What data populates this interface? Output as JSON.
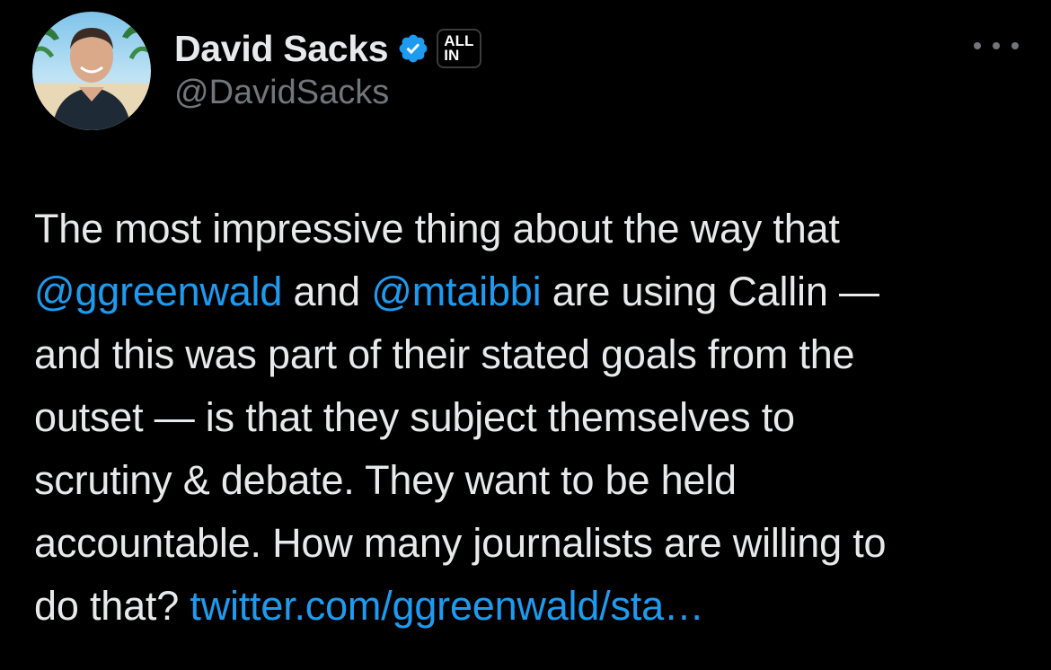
{
  "user": {
    "display_name": "David Sacks",
    "handle": "@DavidSacks",
    "verified_icon": "verified-badge-icon",
    "affiliate_badge_line1": "ALL",
    "affiliate_badge_line2": "IN"
  },
  "more_icon": "more-options-icon",
  "tweet": {
    "lines": [
      [
        {
          "text": "The most impressive thing about the way that",
          "kind": "text"
        }
      ],
      [
        {
          "text": "@ggreenwald",
          "kind": "mention"
        },
        {
          "text": " and ",
          "kind": "text"
        },
        {
          "text": "@mtaibbi",
          "kind": "mention"
        },
        {
          "text": " are using Callin —",
          "kind": "text"
        }
      ],
      [
        {
          "text": "and this was part of their stated goals from the",
          "kind": "text"
        }
      ],
      [
        {
          "text": "outset — is that they subject themselves to",
          "kind": "text"
        }
      ],
      [
        {
          "text": "scrutiny & debate. They want to be held",
          "kind": "text"
        }
      ],
      [
        {
          "text": "accountable. How many journalists are willing to",
          "kind": "text"
        }
      ],
      [
        {
          "text": "do that? ",
          "kind": "text"
        },
        {
          "text": "twitter.com/ggreenwald/sta…",
          "kind": "link"
        }
      ]
    ]
  },
  "colors": {
    "background": "#000000",
    "text": "#e7e9ea",
    "secondary": "#71767b",
    "accent": "#1d9bf0"
  }
}
